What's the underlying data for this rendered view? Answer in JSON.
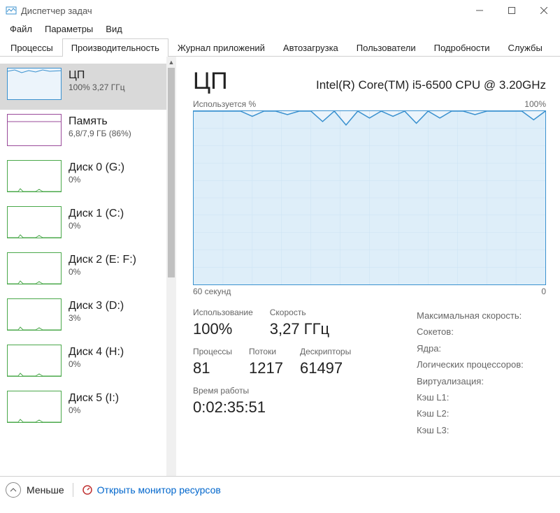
{
  "window": {
    "title": "Диспетчер задач"
  },
  "menu": {
    "file": "Файл",
    "options": "Параметры",
    "view": "Вид"
  },
  "tabs": {
    "processes": "Процессы",
    "performance": "Производительность",
    "apphistory": "Журнал приложений",
    "startup": "Автозагрузка",
    "users": "Пользователи",
    "details": "Подробности",
    "services": "Службы"
  },
  "sidebar": {
    "items": [
      {
        "title": "ЦП",
        "sub": "100% 3,27 ГГц",
        "kind": "cpu"
      },
      {
        "title": "Память",
        "sub": "6,8/7,9 ГБ (86%)",
        "kind": "mem"
      },
      {
        "title": "Диск 0 (G:)",
        "sub": "0%",
        "kind": "disk"
      },
      {
        "title": "Диск 1 (C:)",
        "sub": "0%",
        "kind": "disk"
      },
      {
        "title": "Диск 2 (E: F:)",
        "sub": "0%",
        "kind": "disk"
      },
      {
        "title": "Диск 3 (D:)",
        "sub": "3%",
        "kind": "disk"
      },
      {
        "title": "Диск 4 (H:)",
        "sub": "0%",
        "kind": "disk"
      },
      {
        "title": "Диск 5 (I:)",
        "sub": "0%",
        "kind": "disk"
      }
    ]
  },
  "detail": {
    "title": "ЦП",
    "model": "Intel(R) Core(TM) i5-6500 CPU @ 3.20GHz",
    "y_label": "Используется %",
    "y_max": "100%",
    "x_label": "60 секунд",
    "x_min": "0",
    "stats": {
      "usage_label": "Использование",
      "usage_value": "100%",
      "speed_label": "Скорость",
      "speed_value": "3,27 ГГц",
      "proc_label": "Процессы",
      "proc_value": "81",
      "threads_label": "Потоки",
      "threads_value": "1217",
      "handles_label": "Дескрипторы",
      "handles_value": "61497",
      "uptime_label": "Время работы",
      "uptime_value": "0:02:35:51"
    },
    "right": {
      "maxspeed": "Максимальная скорость:",
      "sockets": "Сокетов:",
      "cores": "Ядра:",
      "lprocs": "Логических процессоров:",
      "virt": "Виртуализация:",
      "l1": "Кэш L1:",
      "l2": "Кэш L2:",
      "l3": "Кэш L3:"
    }
  },
  "footer": {
    "less": "Меньше",
    "open_mon": "Открыть монитор ресурсов"
  },
  "chart_data": {
    "type": "line",
    "title": "Используется %",
    "xlabel": "60 секунд",
    "ylabel": "%",
    "ylim": [
      0,
      100
    ],
    "x": [
      0,
      2,
      4,
      6,
      8,
      10,
      12,
      14,
      16,
      18,
      20,
      22,
      24,
      26,
      28,
      30,
      32,
      34,
      36,
      38,
      40,
      42,
      44,
      46,
      48,
      50,
      52,
      54,
      56,
      58,
      60
    ],
    "values": [
      100,
      100,
      100,
      100,
      100,
      97,
      100,
      100,
      98,
      100,
      100,
      94,
      100,
      92,
      100,
      96,
      100,
      97,
      100,
      93,
      100,
      96,
      100,
      100,
      98,
      100,
      100,
      100,
      100,
      95,
      100
    ]
  }
}
